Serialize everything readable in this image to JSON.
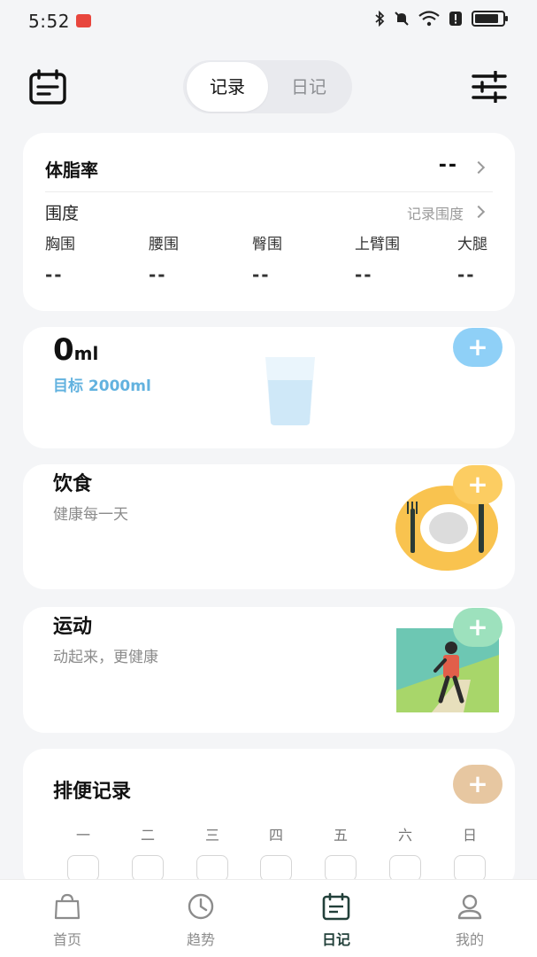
{
  "status_bar": {
    "time": "5:52"
  },
  "header": {
    "tabs": [
      "记录",
      "日记"
    ],
    "active_tab": 0
  },
  "body_fat": {
    "title": "体脂率",
    "value": "--",
    "girth_title": "围度",
    "girth_link": "记录围度",
    "measures": [
      {
        "label": "胸围",
        "value": "--"
      },
      {
        "label": "腰围",
        "value": "--"
      },
      {
        "label": "臀围",
        "value": "--"
      },
      {
        "label": "上臂围",
        "value": "--"
      },
      {
        "label": "大腿",
        "value": "--"
      }
    ]
  },
  "water": {
    "amount": "0",
    "unit": "ml",
    "target": "目标 2000ml",
    "color": "#62b2df"
  },
  "diet": {
    "title": "饮食",
    "subtitle": "健康每一天"
  },
  "sport": {
    "title": "运动",
    "subtitle": "动起来，更健康"
  },
  "stool": {
    "title": "排便记录",
    "days": [
      "一",
      "二",
      "三",
      "四",
      "五",
      "六",
      "日"
    ]
  },
  "add_label": "+",
  "bottom_nav": {
    "items": [
      {
        "label": "首页",
        "icon": "bag-icon"
      },
      {
        "label": "趋势",
        "icon": "clock-icon"
      },
      {
        "label": "日记",
        "icon": "calendar-icon"
      },
      {
        "label": "我的",
        "icon": "user-icon"
      }
    ],
    "active": 2,
    "active_color": "#22403a"
  }
}
